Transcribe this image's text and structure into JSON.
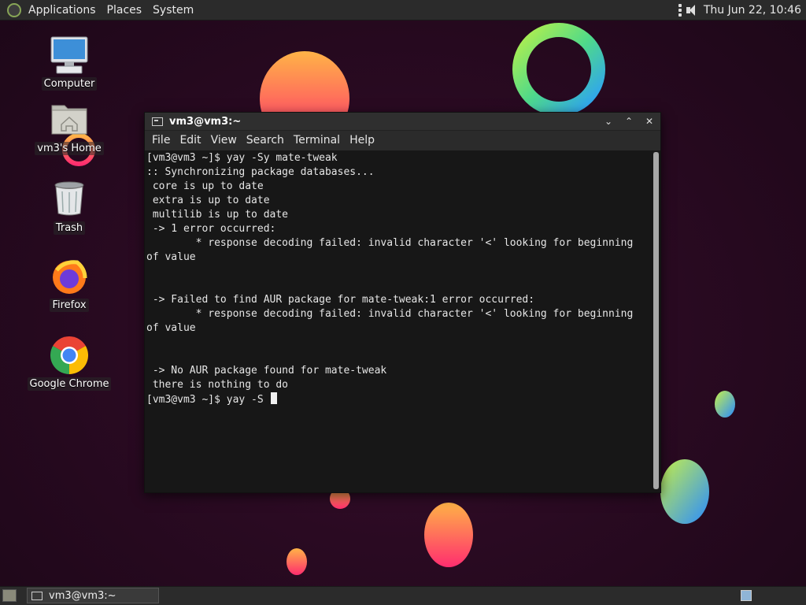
{
  "top_panel": {
    "menus": [
      "Applications",
      "Places",
      "System"
    ],
    "clock": "Thu Jun 22, 10:46"
  },
  "desktop_icons": [
    {
      "label": "Computer",
      "icon": "computer-icon"
    },
    {
      "label": "vm3's Home",
      "icon": "home-folder-icon"
    },
    {
      "label": "Trash",
      "icon": "trash-icon"
    },
    {
      "label": "Firefox",
      "icon": "firefox-icon"
    },
    {
      "label": "Google Chrome",
      "icon": "chrome-icon"
    }
  ],
  "terminal": {
    "title": "vm3@vm3:~",
    "menu": [
      "File",
      "Edit",
      "View",
      "Search",
      "Terminal",
      "Help"
    ],
    "lines": [
      "[vm3@vm3 ~]$ yay -Sy mate-tweak",
      ":: Synchronizing package databases...",
      " core is up to date",
      " extra is up to date",
      " multilib is up to date",
      " -> 1 error occurred:",
      "        * response decoding failed: invalid character '<' looking for beginning",
      "of value",
      "",
      "",
      " -> Failed to find AUR package for mate-tweak:1 error occurred:",
      "        * response decoding failed: invalid character '<' looking for beginning",
      "of value",
      "",
      "",
      " -> No AUR package found for mate-tweak",
      " there is nothing to do",
      "[vm3@vm3 ~]$ yay -S "
    ]
  },
  "bottom_panel": {
    "task_label": "vm3@vm3:~"
  },
  "colors": {
    "desktop_bg": "#2a0a22",
    "panel": "#2b2b2b",
    "terminal_bg": "#171717"
  }
}
